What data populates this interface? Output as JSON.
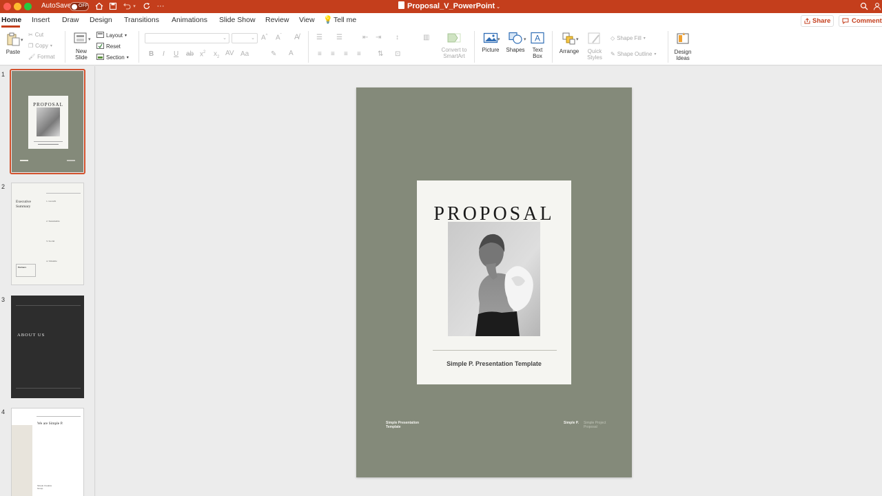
{
  "titlebar": {
    "autosave_label": "AutoSave",
    "autosave_state": "OFF",
    "doc_title": "Proposal_V_PowerPoint",
    "accent_color": "#c43e1c"
  },
  "tabs": {
    "items": [
      "Home",
      "Insert",
      "Draw",
      "Design",
      "Transitions",
      "Animations",
      "Slide Show",
      "Review",
      "View",
      "Tell me"
    ],
    "active": "Home",
    "share": "Share",
    "comments": "Comments"
  },
  "ribbon": {
    "paste": "Paste",
    "cut": "Cut",
    "copy": "Copy",
    "format": "Format",
    "new_slide": [
      "New",
      "Slide"
    ],
    "layout": "Layout",
    "reset": "Reset",
    "section": "Section",
    "convert_smartart": [
      "Convert to",
      "SmartArt"
    ],
    "picture": "Picture",
    "shapes": "Shapes",
    "text_box": [
      "Text",
      "Box"
    ],
    "arrange": "Arrange",
    "quick_styles": [
      "Quick",
      "Styles"
    ],
    "shape_fill": "Shape Fill",
    "shape_outline": "Shape Outline",
    "design_ideas": [
      "Design",
      "Ideas"
    ]
  },
  "slides_panel": {
    "numbers": [
      "1",
      "2",
      "3",
      "4"
    ],
    "thumb1": {
      "title": "PROPOSAL"
    },
    "thumb2": {
      "heading": [
        "Executive",
        "Summary"
      ],
      "items": [
        "1. Growth",
        "2. Sustainable",
        "3. Social",
        "4. Valuable"
      ],
      "box_label": "Partners"
    },
    "thumb3": {
      "title": "ABOUT US"
    },
    "thumb4": {
      "title": "We are Simple P.",
      "foot": [
        "Simple Creative",
        "Group"
      ]
    }
  },
  "slide": {
    "title": "PROPOSAL",
    "subtitle": "Simple P. Presentation Template",
    "footer_left": [
      "Simple Presentation",
      "Template"
    ],
    "footer_brand": "Simple P.",
    "footer_right": [
      "Simple Project",
      "Proposal"
    ],
    "background_color": "#848a7a"
  }
}
